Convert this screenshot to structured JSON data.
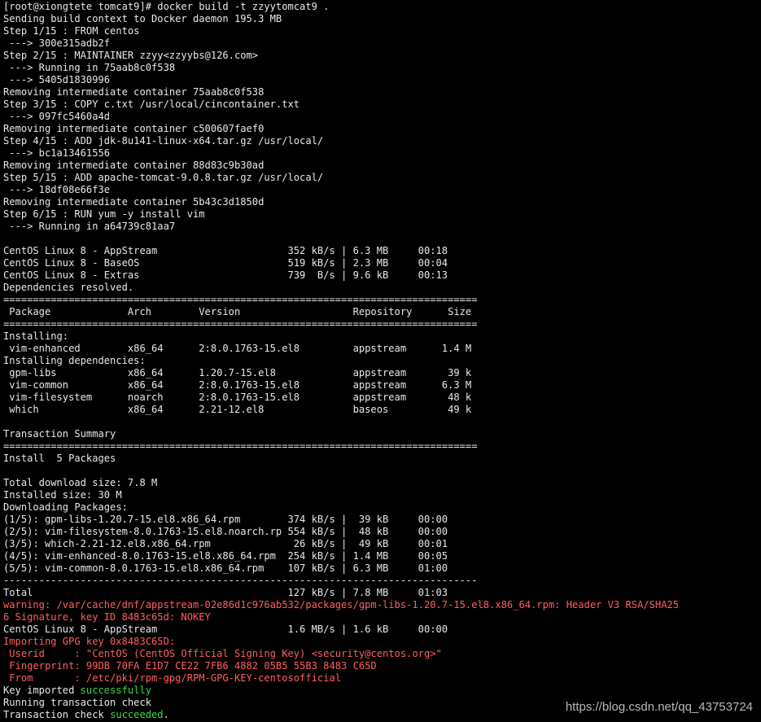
{
  "terminal": {
    "lines": [
      [
        {
          "t": "[root@xiongtete tomcat9]# docker build -t zzyytomcat9 ."
        }
      ],
      [
        {
          "t": "Sending build context to Docker daemon 195.3 MB"
        }
      ],
      [
        {
          "t": "Step 1/15 : FROM centos"
        }
      ],
      [
        {
          "t": " ---> 300e315adb2f"
        }
      ],
      [
        {
          "t": "Step 2/15 : MAINTAINER zzyy<zzyybs@126.com>"
        }
      ],
      [
        {
          "t": " ---> Running in 75aab8c0f538"
        }
      ],
      [
        {
          "t": " ---> 5405d1830996"
        }
      ],
      [
        {
          "t": "Removing intermediate container 75aab8c0f538"
        }
      ],
      [
        {
          "t": "Step 3/15 : COPY c.txt /usr/local/cincontainer.txt"
        }
      ],
      [
        {
          "t": " ---> 097fc5460a4d"
        }
      ],
      [
        {
          "t": "Removing intermediate container c500607faef0"
        }
      ],
      [
        {
          "t": "Step 4/15 : ADD jdk-8u141-linux-x64.tar.gz /usr/local/"
        }
      ],
      [
        {
          "t": " ---> bc1a13461556"
        }
      ],
      [
        {
          "t": "Removing intermediate container 88d83c9b30ad"
        }
      ],
      [
        {
          "t": "Step 5/15 : ADD apache-tomcat-9.0.8.tar.gz /usr/local/"
        }
      ],
      [
        {
          "t": " ---> 18df08e66f3e"
        }
      ],
      [
        {
          "t": "Removing intermediate container 5b43c3d1850d"
        }
      ],
      [
        {
          "t": "Step 6/15 : RUN yum -y install vim"
        }
      ],
      [
        {
          "t": " ---> Running in a64739c81aa7"
        }
      ],
      [
        {
          "t": ""
        }
      ],
      [
        {
          "t": "CentOS Linux 8 - AppStream                      352 kB/s | 6.3 MB     00:18"
        }
      ],
      [
        {
          "t": "CentOS Linux 8 - BaseOS                         519 kB/s | 2.3 MB     00:04"
        }
      ],
      [
        {
          "t": "CentOS Linux 8 - Extras                         739  B/s | 9.6 kB     00:13"
        }
      ],
      [
        {
          "t": "Dependencies resolved."
        }
      ],
      [
        {
          "t": "================================================================================"
        }
      ],
      [
        {
          "t": " Package             Arch        Version                   Repository      Size"
        }
      ],
      [
        {
          "t": "================================================================================"
        }
      ],
      [
        {
          "t": "Installing:"
        }
      ],
      [
        {
          "t": " vim-enhanced        x86_64      2:8.0.1763-15.el8         appstream      1.4 M"
        }
      ],
      [
        {
          "t": "Installing dependencies:"
        }
      ],
      [
        {
          "t": " gpm-libs            x86_64      1.20.7-15.el8             appstream       39 k"
        }
      ],
      [
        {
          "t": " vim-common          x86_64      2:8.0.1763-15.el8         appstream      6.3 M"
        }
      ],
      [
        {
          "t": " vim-filesystem      noarch      2:8.0.1763-15.el8         appstream       48 k"
        }
      ],
      [
        {
          "t": " which               x86_64      2.21-12.el8               baseos          49 k"
        }
      ],
      [
        {
          "t": ""
        }
      ],
      [
        {
          "t": "Transaction Summary"
        }
      ],
      [
        {
          "t": "================================================================================"
        }
      ],
      [
        {
          "t": "Install  5 Packages"
        }
      ],
      [
        {
          "t": ""
        }
      ],
      [
        {
          "t": "Total download size: 7.8 M"
        }
      ],
      [
        {
          "t": "Installed size: 30 M"
        }
      ],
      [
        {
          "t": "Downloading Packages:"
        }
      ],
      [
        {
          "t": "(1/5): gpm-libs-1.20.7-15.el8.x86_64.rpm        374 kB/s |  39 kB     00:00"
        }
      ],
      [
        {
          "t": "(2/5): vim-filesystem-8.0.1763-15.el8.noarch.rp 554 kB/s |  48 kB     00:00"
        }
      ],
      [
        {
          "t": "(3/5): which-2.21-12.el8.x86_64.rpm              26 kB/s |  49 kB     00:01"
        }
      ],
      [
        {
          "t": "(4/5): vim-enhanced-8.0.1763-15.el8.x86_64.rpm  254 kB/s | 1.4 MB     00:05"
        }
      ],
      [
        {
          "t": "(5/5): vim-common-8.0.1763-15.el8.x86_64.rpm    107 kB/s | 6.3 MB     01:00"
        }
      ],
      [
        {
          "t": "--------------------------------------------------------------------------------"
        }
      ],
      [
        {
          "t": "Total                                           127 kB/s | 7.8 MB     01:03"
        }
      ],
      [
        {
          "t": "warning: /var/cache/dnf/appstream-02e86d1c976ab532/packages/gpm-libs-1.20.7-15.el8.x86_64.rpm: Header V3 RSA/SHA25",
          "c": "warn"
        }
      ],
      [
        {
          "t": "6 Signature, key ID 8483c65d: NOKEY",
          "c": "warn"
        }
      ],
      [
        {
          "t": "CentOS Linux 8 - AppStream                      1.6 MB/s | 1.6 kB     00:00"
        }
      ],
      [
        {
          "t": "Importing GPG key 0x8483C65D:",
          "c": "warn"
        }
      ],
      [
        {
          "t": " Userid     : \"CentOS (CentOS Official Signing Key) <security@centos.org>\"",
          "c": "warn"
        }
      ],
      [
        {
          "t": " Fingerprint: 99DB 70FA E1D7 CE22 7FB6 4882 05B5 55B3 8483 C65D",
          "c": "warn"
        }
      ],
      [
        {
          "t": " From       : /etc/pki/rpm-gpg/RPM-GPG-KEY-centosofficial",
          "c": "warn"
        }
      ],
      [
        {
          "t": "Key imported "
        },
        {
          "t": "successfully",
          "c": "ok"
        }
      ],
      [
        {
          "t": "Running transaction check"
        }
      ],
      [
        {
          "t": "Transaction check "
        },
        {
          "t": "succeeded",
          "c": "ok"
        },
        {
          "t": "."
        }
      ]
    ]
  },
  "watermark": "https://blog.csdn.net/qq_43753724",
  "colors": {
    "background": "#000000",
    "foreground": "#e8e8e8",
    "warning": "#ff5f5f",
    "success": "#3ddc3d"
  }
}
